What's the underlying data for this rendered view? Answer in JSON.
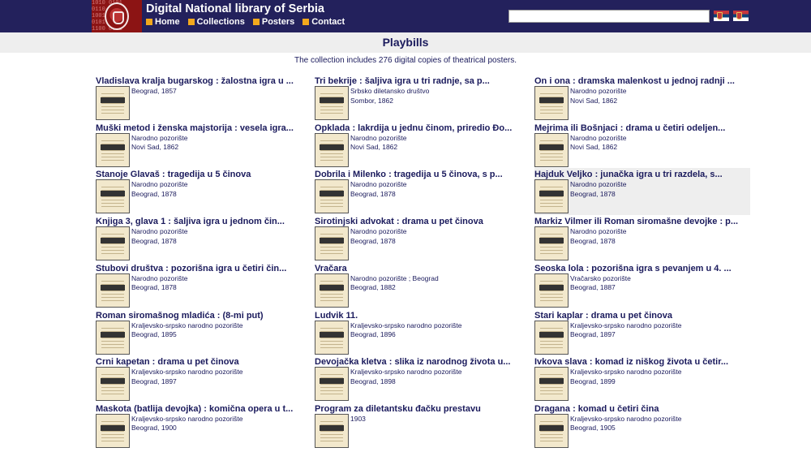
{
  "site": {
    "title": "Digital National library of Serbia",
    "nav": [
      "Home",
      "Collections",
      "Posters",
      "Contact"
    ],
    "logo_bits": "1010 0101\n0110 1001\n1001 0110\n0101 1010\n1100 0011"
  },
  "collection": {
    "heading": "Playbills",
    "intro": "The collection includes 276 digital copies of theatrical posters."
  },
  "items": [
    {
      "title": "Vladislava kralja bugarskog : žalostna igra u ...",
      "publisher": "",
      "place_year": "Beograd, 1857"
    },
    {
      "title": "Tri bekrije : šaljiva igra u tri radnje, sa p...",
      "publisher": "Srbsko diletansko društvo",
      "place_year": "Sombor, 1862"
    },
    {
      "title": "On i ona : dramska malenkost u jednoj radnji ...",
      "publisher": "Narodno pozorište",
      "place_year": "Novi Sad, 1862"
    },
    {
      "title": "Muški metod i ženska majstorija : vesela igra...",
      "publisher": "Narodno pozorište",
      "place_year": "Novi Sad, 1862"
    },
    {
      "title": "Opklada : lakrdija u jednu činom, priredio Đo...",
      "publisher": "Narodno pozorište",
      "place_year": "Novi Sad, 1862"
    },
    {
      "title": "Mejrima ili Bošnjaci : drama u četiri odeljen...",
      "publisher": "Narodno pozorište",
      "place_year": "Novi Sad, 1862"
    },
    {
      "title": "Stanoje Glavaš : tragedija u 5 činova",
      "publisher": "Narodno pozorište",
      "place_year": "Beograd, 1878"
    },
    {
      "title": "Dobrila i Milenko : tragedija u 5 činova, s p...",
      "publisher": "Narodno pozorište",
      "place_year": "Beograd, 1878"
    },
    {
      "title": "Hajduk Veljko : junačka igra u tri razdela, s...",
      "publisher": "Narodno pozorište",
      "place_year": "Beograd, 1878"
    },
    {
      "title": "Knjiga 3, glava 1 : šaljiva igra u jednom čin...",
      "publisher": "Narodno pozorište",
      "place_year": "Beograd, 1878"
    },
    {
      "title": "Sirotinjski advokat : drama u pet činova",
      "publisher": "Narodno pozorište",
      "place_year": "Beograd, 1878"
    },
    {
      "title": "Markiz Vilmer ili Roman siromašne devojke : p...",
      "publisher": "Narodno pozorište",
      "place_year": "Beograd, 1878"
    },
    {
      "title": "Stubovi društva : pozorišna igra u četiri čin...",
      "publisher": "Narodno pozorište",
      "place_year": "Beograd, 1878"
    },
    {
      "title": "Vračara",
      "publisher": "Narodno pozorište ; Beograd",
      "place_year": "Beograd, 1882"
    },
    {
      "title": "Seoska lola : pozorišna igra s pevanjem u 4. ...",
      "publisher": "Vračarsko pozorište",
      "place_year": "Beograd, 1887"
    },
    {
      "title": "Roman siromašnog mladića : (8-mi put)",
      "publisher": "Kraljevsko-srpsko narodno pozorište",
      "place_year": "Beograd, 1895"
    },
    {
      "title": "Ludvik 11.",
      "publisher": "Kraljevsko-srpsko narodno pozorište",
      "place_year": "Beograd, 1896"
    },
    {
      "title": "Stari kaplar : drama u pet činova",
      "publisher": "Kraljevsko-srpsko narodno pozorište",
      "place_year": "Beograd, 1897"
    },
    {
      "title": "Crni kapetan : drama u pet činova",
      "publisher": "Kraljevsko-srpsko narodno pozorište",
      "place_year": "Beograd, 1897"
    },
    {
      "title": "Devojačka kletva : slika iz narodnog života u...",
      "publisher": "Kraljevsko-srpsko narodno pozorište",
      "place_year": "Beograd, 1898"
    },
    {
      "title": "Ivkova slava : komad iz niškog života u četir...",
      "publisher": "Kraljevsko-srpsko narodno pozorište",
      "place_year": "Beograd, 1899"
    },
    {
      "title": "Maskota (batlija devojka) : komična opera u t...",
      "publisher": "Kraljevsko-srpsko narodno pozorište",
      "place_year": "Beograd, 1900"
    },
    {
      "title": "Program za diletantsku đačku prestavu",
      "publisher": "1903",
      "place_year": ""
    },
    {
      "title": "Dragana : komad u četiri čina",
      "publisher": "Kraljevsko-srpsko narodno pozorište",
      "place_year": "Beograd, 1905"
    }
  ],
  "highlighted_index": 8,
  "colors": {
    "header_bg": "#23215c",
    "accent": "#f2a81d",
    "text": "#1a1a5c",
    "band": "#eeeeee"
  }
}
